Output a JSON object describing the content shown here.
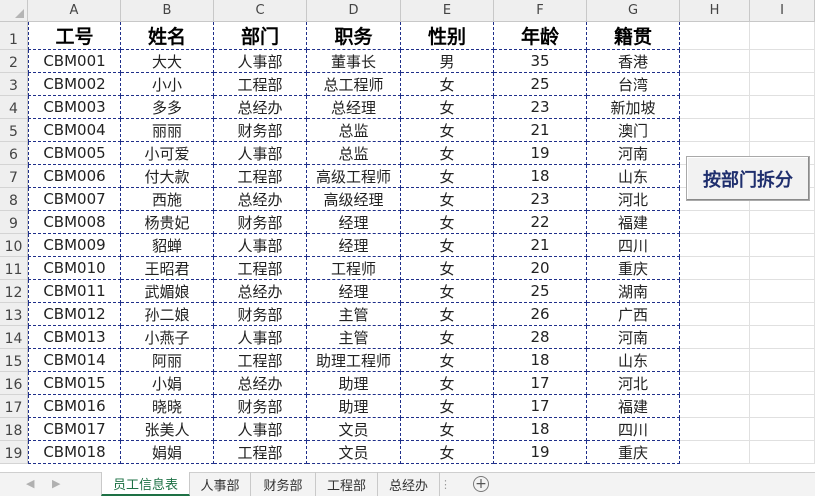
{
  "columns": [
    "A",
    "B",
    "C",
    "D",
    "E",
    "F",
    "G",
    "H",
    "I"
  ],
  "row_numbers": [
    "1",
    "2",
    "3",
    "4",
    "5",
    "6",
    "7",
    "8",
    "9",
    "10",
    "11",
    "12",
    "13",
    "14",
    "15",
    "16",
    "17",
    "18",
    "19"
  ],
  "table": {
    "headers": [
      "工号",
      "姓名",
      "部门",
      "职务",
      "性别",
      "年龄",
      "籍贯"
    ],
    "rows": [
      [
        "CBM001",
        "大大",
        "人事部",
        "董事长",
        "男",
        "35",
        "香港"
      ],
      [
        "CBM002",
        "小小",
        "工程部",
        "总工程师",
        "女",
        "25",
        "台湾"
      ],
      [
        "CBM003",
        "多多",
        "总经办",
        "总经理",
        "女",
        "23",
        "新加坡"
      ],
      [
        "CBM004",
        "丽丽",
        "财务部",
        "总监",
        "女",
        "21",
        "澳门"
      ],
      [
        "CBM005",
        "小可爱",
        "人事部",
        "总监",
        "女",
        "19",
        "河南"
      ],
      [
        "CBM006",
        "付大款",
        "工程部",
        "高级工程师",
        "女",
        "18",
        "山东"
      ],
      [
        "CBM007",
        "西施",
        "总经办",
        "高级经理",
        "女",
        "23",
        "河北"
      ],
      [
        "CBM008",
        "杨贵妃",
        "财务部",
        "经理",
        "女",
        "22",
        "福建"
      ],
      [
        "CBM009",
        "貂蝉",
        "人事部",
        "经理",
        "女",
        "21",
        "四川"
      ],
      [
        "CBM010",
        "王昭君",
        "工程部",
        "工程师",
        "女",
        "20",
        "重庆"
      ],
      [
        "CBM011",
        "武媚娘",
        "总经办",
        "经理",
        "女",
        "25",
        "湖南"
      ],
      [
        "CBM012",
        "孙二娘",
        "财务部",
        "主管",
        "女",
        "26",
        "广西"
      ],
      [
        "CBM013",
        "小燕子",
        "人事部",
        "主管",
        "女",
        "28",
        "河南"
      ],
      [
        "CBM014",
        "阿丽",
        "工程部",
        "助理工程师",
        "女",
        "18",
        "山东"
      ],
      [
        "CBM015",
        "小娟",
        "总经办",
        "助理",
        "女",
        "17",
        "河北"
      ],
      [
        "CBM016",
        "晓晓",
        "财务部",
        "助理",
        "女",
        "17",
        "福建"
      ],
      [
        "CBM017",
        "张美人",
        "人事部",
        "文员",
        "女",
        "18",
        "四川"
      ],
      [
        "CBM018",
        "娟娟",
        "工程部",
        "文员",
        "女",
        "19",
        "重庆"
      ]
    ]
  },
  "split_button": {
    "label": "按部门拆分"
  },
  "sheet_tabs": [
    {
      "label": "员工信息表",
      "active": true
    },
    {
      "label": "人事部",
      "active": false
    },
    {
      "label": "财务部",
      "active": false
    },
    {
      "label": "工程部",
      "active": false
    },
    {
      "label": "总经办",
      "active": false
    }
  ],
  "add_sheet_icon": "plus-circle-icon",
  "colors": {
    "table_border": "#1f2f8a",
    "active_tab": "#1e7145",
    "button_text": "#1f2f6e"
  }
}
